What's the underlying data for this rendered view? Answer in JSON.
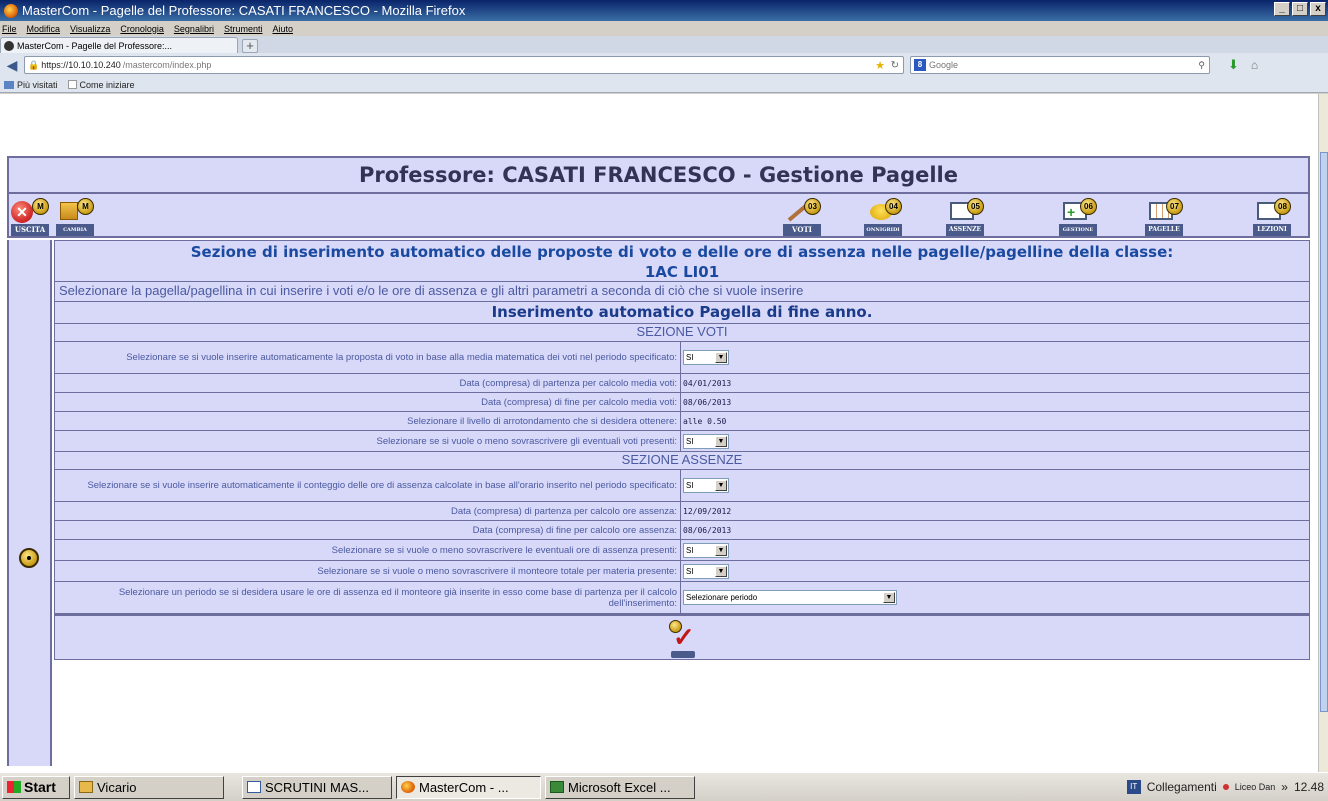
{
  "window": {
    "title": "MasterCom - Pagelle del Professore: CASATI FRANCESCO - Mozilla Firefox",
    "controls": [
      "_",
      "□",
      "x"
    ]
  },
  "menu": [
    "File",
    "Modifica",
    "Visualizza",
    "Cronologia",
    "Segnalibri",
    "Strumenti",
    "Aiuto"
  ],
  "tab": {
    "label": "MasterCom - Pagelle del Professore:...",
    "new_tab": "+"
  },
  "nav": {
    "url_host": "https://10.10.10.240",
    "url_path": "/mastercom/index.php",
    "search_engine": "Google",
    "search_placeholder": "Google"
  },
  "bookmarks": [
    "Più visitati",
    "Come iniziare"
  ],
  "page": {
    "title": "Professore: CASATI FRANCESCO - Gestione Pagelle",
    "toolbar_left": [
      {
        "badge": "M",
        "label": "USCITA",
        "icon": "exit-icon"
      },
      {
        "badge": "M",
        "label": "CAMBIA PASSWORD",
        "icon": "lock-icon"
      }
    ],
    "toolbar_right": [
      {
        "badge": "03",
        "label": "VOTI",
        "icon": "pen-icon"
      },
      {
        "badge": "04",
        "label": "ONNIGRIDI",
        "icon": "coins-icon"
      },
      {
        "badge": "05",
        "label": "ASSENZE",
        "icon": "calendar-icon"
      },
      {
        "badge": "06",
        "label": "GESTIONE",
        "icon": "calendar-add-icon"
      },
      {
        "badge": "07",
        "label": "PAGELLE",
        "icon": "grid-icon"
      },
      {
        "badge": "08",
        "label": "LEZIONI",
        "icon": "calendar-icon"
      }
    ],
    "section_heading_line1": "Sezione di inserimento automatico delle proposte di voto e delle ore di assenza nelle pagelle/pagelline della classe:",
    "section_heading_line2": "1AC LI01",
    "instructions": "Selezionare la pagella/pagellina in cui inserire i voti e/o le ore di assenza e gli altri parametri a seconda di ciò che si vuole inserire",
    "subtitle": "Inserimento automatico Pagella di fine anno.",
    "sezione_voti": "SEZIONE VOTI",
    "sezione_assenze": "SEZIONE ASSENZE",
    "voti_rows": {
      "auto_media_label": "Selezionare se si vuole inserire automaticamente la proposta di voto in base alla media matematica dei voti nel periodo specificato:",
      "auto_media_value": "SI",
      "data_partenza_label": "Data (compresa) di partenza per calcolo media voti:",
      "data_partenza_value": "04/01/2013",
      "data_fine_label": "Data (compresa) di fine per calcolo media voti:",
      "data_fine_value": "08/06/2013",
      "arrotondamento_label": "Selezionare il livello di arrotondamento che si desidera ottenere:",
      "arrotondamento_value": "alle 0.50",
      "sovrascrivi_label": "Selezionare se si vuole o meno sovrascrivere gli eventuali voti presenti:",
      "sovrascrivi_value": "SI"
    },
    "assenze_rows": {
      "auto_conteggio_label": "Selezionare se si vuole inserire automaticamente il conteggio delle ore di assenza calcolate in base all'orario inserito nel periodo specificato:",
      "auto_conteggio_value": "SI",
      "data_partenza_label": "Data (compresa) di partenza per calcolo ore assenza:",
      "data_partenza_value": "12/09/2012",
      "data_fine_label": "Data (compresa) di fine per calcolo ore assenza:",
      "data_fine_value": "08/06/2013",
      "sovrascrivi_ore_label": "Selezionare se si vuole o meno sovrascrivere le eventuali ore di assenza presenti:",
      "sovrascrivi_ore_value": "SI",
      "sovrascrivi_monteore_label": "Selezionare se si vuole o meno sovrascrivere il monteore totale per materia presente:",
      "sovrascrivi_monteore_value": "SI",
      "periodo_label": "Selezionare un periodo se si desidera usare le ore di assenza ed il monteore già inserite in esso come base di partenza per il calcolo dell'inserimento:",
      "periodo_value": "Selezionare periodo"
    }
  },
  "taskbar": {
    "start": "Start",
    "tasks": [
      "Vicario",
      "SCRUTINI MAS...",
      "MasterCom - ...",
      "Microsoft Excel ..."
    ],
    "tray_lang": "IT",
    "tray_links": "Collegamenti",
    "tray_user": "Liceo Dan",
    "tray_more": "»",
    "clock": "12.48"
  }
}
